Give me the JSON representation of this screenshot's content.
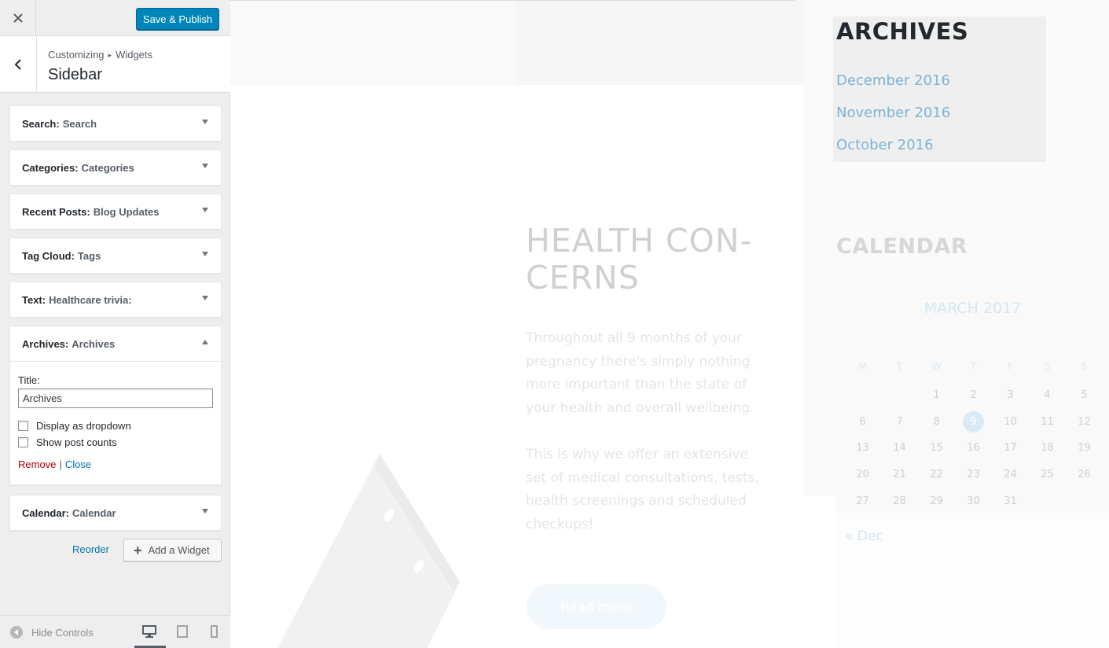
{
  "topbar": {
    "publish_label": "Save & Publish"
  },
  "header": {
    "breadcrumb_root": "Customizing",
    "breadcrumb_current": "Widgets",
    "section_title": "Sidebar"
  },
  "widgets": [
    {
      "name": "Search:",
      "title": "Search"
    },
    {
      "name": "Categories:",
      "title": "Categories"
    },
    {
      "name": "Recent Posts:",
      "title": "Blog Updates"
    },
    {
      "name": "Tag Cloud:",
      "title": "Tags"
    },
    {
      "name": "Text:",
      "title": "Healthcare trivia:"
    },
    {
      "name": "Archives:",
      "title": "Archives"
    },
    {
      "name": "Calendar:",
      "title": "Calendar"
    }
  ],
  "archives_form": {
    "title_label": "Title:",
    "title_value": "Archives",
    "dropdown_label": "Display as dropdown",
    "counts_label": "Show post counts",
    "remove_label": "Remove",
    "close_label": "Close"
  },
  "panel_actions": {
    "reorder_label": "Reorder",
    "add_widget_label": "Add a Widget"
  },
  "footer": {
    "hide_controls_label": "Hide Controls"
  },
  "preview": {
    "hero_title": "HEALTH CON-CERNS",
    "hero_p1": "Throughout all 9 months of your pregnancy there's simply nothing more important than the state of your health and overall wellbeing.",
    "hero_p2": "This is why we offer an extensive set of medical consultations, tests, health screenings and scheduled checkups!",
    "read_more": "Read more",
    "archives_heading": "ARCHIVES",
    "archive_links": [
      "December 2016",
      "November 2016",
      "October 2016"
    ],
    "calendar_heading": "CALENDAR",
    "calendar_caption": "MARCH 2017",
    "weekdays": [
      "M",
      "T",
      "W",
      "T",
      "F",
      "S",
      "S"
    ],
    "calendar_days": [
      "",
      "",
      "1",
      "2",
      "3",
      "4",
      "5",
      "6",
      "7",
      "8",
      "9",
      "10",
      "11",
      "12",
      "13",
      "14",
      "15",
      "16",
      "17",
      "18",
      "19",
      "20",
      "21",
      "22",
      "23",
      "24",
      "25",
      "26",
      "27",
      "28",
      "29",
      "30",
      "31",
      "",
      ""
    ],
    "today": "9",
    "prev_month_link": "« Dec"
  }
}
